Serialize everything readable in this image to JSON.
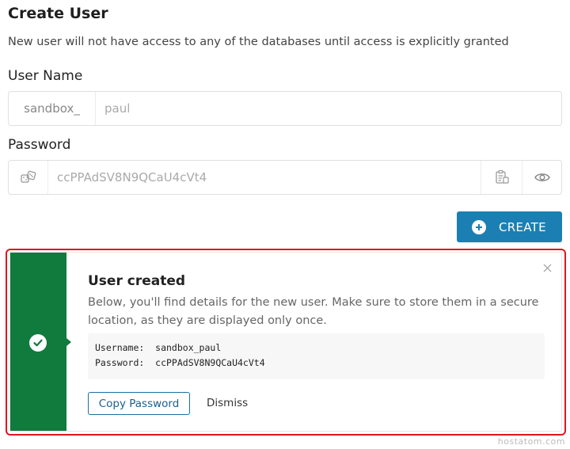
{
  "header": {
    "title": "Create User",
    "subtitle": "New user will not have access to any of the databases until access is explicitly granted"
  },
  "form": {
    "username_label": "User Name",
    "username_prefix": "sandbox_",
    "username_value": "paul",
    "password_label": "Password",
    "password_value": "ccPPAdSV8N9QCaU4cVt4",
    "icons": {
      "generate": "dice-icon",
      "copy": "clipboard-icon",
      "reveal": "eye-icon"
    },
    "create_label": "CREATE"
  },
  "alert": {
    "title": "User created",
    "description": "Below, you'll find details for the new user. Make sure to store them in a secure location, as they are displayed only once.",
    "credentials": [
      "Username:  sandbox_paul",
      "Password:  ccPPAdSV8N9QCaU4cVt4"
    ],
    "copy_password_label": "Copy Password",
    "dismiss_label": "Dismiss",
    "status_color": "#117a3d"
  },
  "watermark": "hostatom.com",
  "colors": {
    "accent": "#1b7fb3",
    "success": "#117a3d",
    "highlight": "#e0161e"
  }
}
